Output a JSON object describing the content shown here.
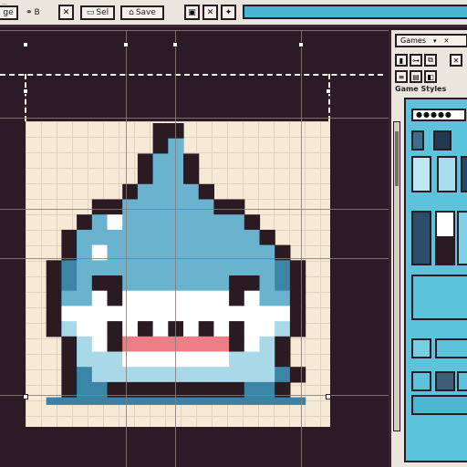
{
  "toolbar": {
    "caption": "...",
    "edge_label": "ge",
    "undo_label": "B",
    "sel_label": "Sel",
    "save_label": "Save",
    "accent_color": "#4cb6d2"
  },
  "panel": {
    "tab_label": "Games",
    "section_title": "Game Styles",
    "search_value": "●●●●●",
    "style_color": "#5cc3dc"
  },
  "sprite": {
    "palette": {
      "outline": "#2a1a22",
      "body": "#6ab3cf",
      "body_dark": "#3b86a6",
      "belly": "#ffffff",
      "belly_shade": "#a9d8e8",
      "mouth": "#ef7d88",
      "mouth_dark": "#2a1a22",
      "shadow": "#3d7fa5"
    }
  }
}
